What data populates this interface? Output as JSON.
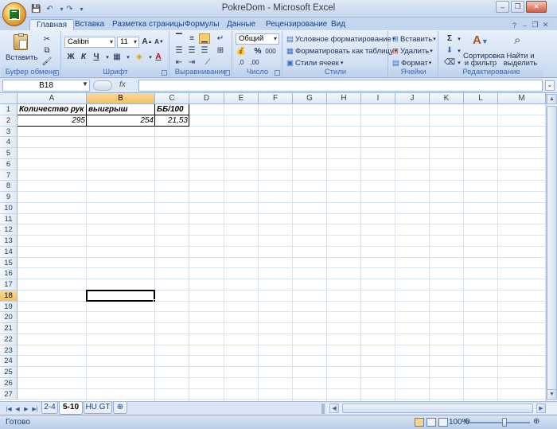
{
  "window": {
    "title": "PokreDom - Microsoft Excel"
  },
  "tabs": [
    "Главная",
    "Вставка",
    "Разметка страницы",
    "Формулы",
    "Данные",
    "Рецензирование",
    "Вид"
  ],
  "clipboard": {
    "paste_label": "Вставить",
    "group_label": "Буфер обмена"
  },
  "font": {
    "name": "Calibri",
    "size": "11",
    "bold": "Ж",
    "italic": "К",
    "underline": "Ч",
    "group_label": "Шрифт"
  },
  "alignment": {
    "group_label": "Выравнивание"
  },
  "number": {
    "format": "Общий",
    "group_label": "Число"
  },
  "styles": {
    "conditional": "Условное форматирование",
    "as_table": "Форматировать как таблицу",
    "cell_styles": "Стили ячеек",
    "group_label": "Стили"
  },
  "cells": {
    "insert": "Вставить",
    "delete": "Удалить",
    "format": "Формат",
    "group_label": "Ячейки"
  },
  "editing": {
    "sort_filter_1": "Сортировка",
    "sort_filter_2": "и фильтр",
    "find_1": "Найти и",
    "find_2": "выделить",
    "group_label": "Редактирование"
  },
  "formula_bar": {
    "name_box": "B18",
    "fx": "fx",
    "formula": ""
  },
  "columns": [
    "A",
    "B",
    "C",
    "D",
    "E",
    "F",
    "G",
    "H",
    "I",
    "J",
    "K",
    "L",
    "M"
  ],
  "rows": [
    "1",
    "2",
    "3",
    "4",
    "5",
    "6",
    "7",
    "8",
    "9",
    "10",
    "11",
    "12",
    "13",
    "14",
    "15",
    "16",
    "17",
    "18",
    "19",
    "20",
    "21",
    "22",
    "23",
    "24",
    "25",
    "26",
    "27"
  ],
  "data": {
    "A1": "Количество рук",
    "B1": "выигрыш",
    "C1": "ББ/100",
    "A2": "295",
    "B2": "254",
    "C2": "21,53"
  },
  "active_cell": "B18",
  "sheets": [
    "2-4",
    "5-10",
    "HU GT"
  ],
  "active_sheet": "5-10",
  "status": {
    "ready": "Готово",
    "zoom": "100%"
  }
}
